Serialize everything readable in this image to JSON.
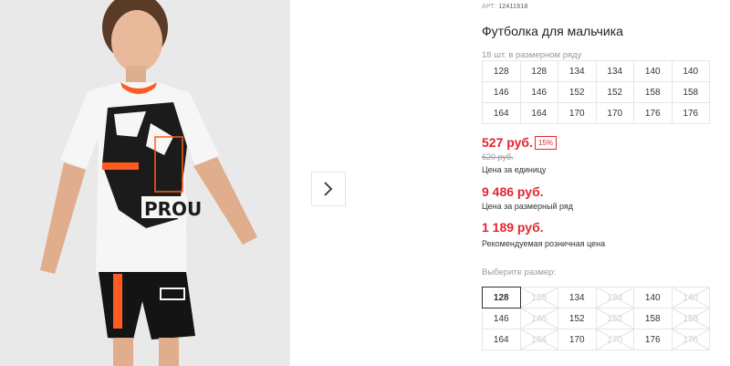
{
  "product": {
    "sku_label": "АРТ:",
    "sku_value": "12411918",
    "title": "Футболка для мальчика",
    "series_note": "18 шт. в размерном ряду"
  },
  "size_series": [
    [
      "128",
      "128",
      "134",
      "134",
      "140",
      "140"
    ],
    [
      "146",
      "146",
      "152",
      "152",
      "158",
      "158"
    ],
    [
      "164",
      "164",
      "170",
      "170",
      "176",
      "176"
    ]
  ],
  "pricing": {
    "unit_price": "527 руб.",
    "discount": "15%",
    "old_price": "620 руб.",
    "unit_price_label": "Цена за единицу",
    "series_price": "9 486 руб.",
    "series_price_label": "Цена за размерный ряд",
    "retail_price": "1 189 руб.",
    "retail_price_label": "Рекомендуемая розничная цена"
  },
  "size_picker": {
    "label": "Выберите размер:",
    "rows": [
      [
        "128",
        "134",
        "134",
        "140",
        "140",
        "146"
      ],
      [
        "146",
        "152",
        "152",
        "158",
        "158",
        "164"
      ],
      [
        "164",
        "170",
        "170",
        "176",
        "176",
        "176"
      ]
    ],
    "display_rows": [
      [
        {
          "v": "128",
          "s": "selected"
        },
        {
          "v": "128",
          "s": "disabled"
        },
        {
          "v": "134",
          "s": "available"
        },
        {
          "v": "134",
          "s": "disabled"
        },
        {
          "v": "140",
          "s": "available"
        },
        {
          "v": "140",
          "s": "disabled"
        }
      ],
      [
        {
          "v": "146",
          "s": "available"
        },
        {
          "v": "146",
          "s": "disabled"
        },
        {
          "v": "152",
          "s": "available"
        },
        {
          "v": "152",
          "s": "disabled"
        },
        {
          "v": "158",
          "s": "available"
        },
        {
          "v": "158",
          "s": "disabled"
        }
      ],
      [
        {
          "v": "164",
          "s": "available"
        },
        {
          "v": "164",
          "s": "disabled"
        },
        {
          "v": "170",
          "s": "available"
        },
        {
          "v": "170",
          "s": "disabled"
        },
        {
          "v": "176",
          "s": "available"
        },
        {
          "v": "176",
          "s": "disabled"
        }
      ]
    ]
  },
  "colors": {
    "price_red": "#e3262e",
    "accent_orange": "#ff5a1f"
  },
  "icons": {
    "next": "chevron-right-icon"
  }
}
